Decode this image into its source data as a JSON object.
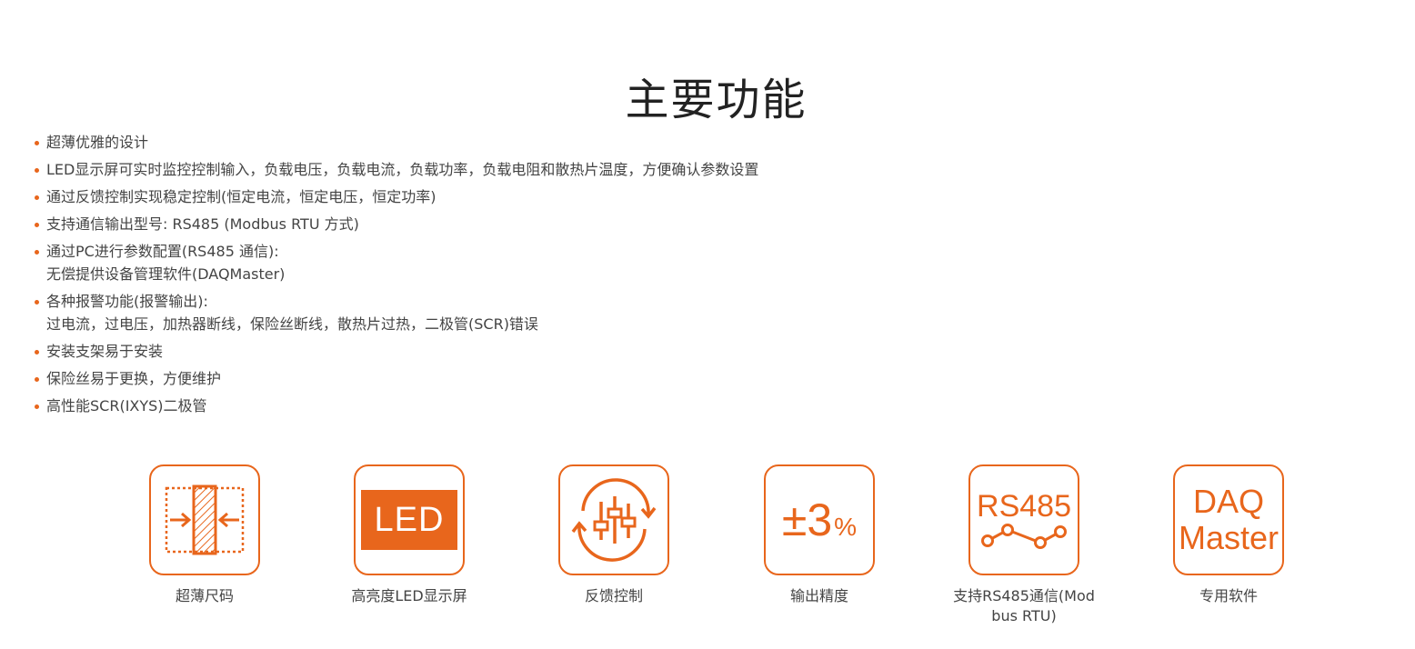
{
  "title": "主要功能",
  "features": [
    {
      "lines": [
        "超薄优雅的设计"
      ]
    },
    {
      "lines": [
        "LED显示屏可实时监控控制输入，负载电压，负载电流，负载功率，负载电阻和散热片温度，方便确认参数设置"
      ]
    },
    {
      "lines": [
        "通过反馈控制实现稳定控制(恒定电流，恒定电压，恒定功率)"
      ]
    },
    {
      "lines": [
        "支持通信输出型号: RS485 (Modbus RTU 方式)"
      ]
    },
    {
      "lines": [
        "通过PC进行参数配置(RS485 通信):",
        "无偿提供设备管理软件(DAQMaster)"
      ]
    },
    {
      "lines": [
        "各种报警功能(报警输出):",
        "过电流，过电压，加热器断线，保险丝断线，散热片过热，二极管(SCR)错误"
      ]
    },
    {
      "lines": [
        "安装支架易于安装"
      ]
    },
    {
      "lines": [
        "保险丝易于更换，方便维护"
      ]
    },
    {
      "lines": [
        "高性能SCR(IXYS)二极管"
      ]
    }
  ],
  "icons": [
    {
      "icon": "slim-size-icon",
      "label_lines": [
        "超薄尺码"
      ]
    },
    {
      "icon": "led-display-icon",
      "text": "LED",
      "label_lines": [
        "高亮度LED显示屏"
      ]
    },
    {
      "icon": "feedback-control-icon",
      "label_lines": [
        "反馈控制"
      ]
    },
    {
      "icon": "accuracy-icon",
      "text": "±3",
      "unit": "%",
      "label_lines": [
        "输出精度"
      ]
    },
    {
      "icon": "rs485-icon",
      "text": "RS485",
      "label_lines": [
        "支持RS485通信(Mod",
        "bus RTU)"
      ]
    },
    {
      "icon": "daqmaster-icon",
      "text_lines": [
        "DAQ",
        "Master"
      ],
      "label_lines": [
        "专用软件"
      ]
    }
  ],
  "colors": {
    "accent": "#e8661c",
    "text": "#444444",
    "title": "#222222"
  }
}
